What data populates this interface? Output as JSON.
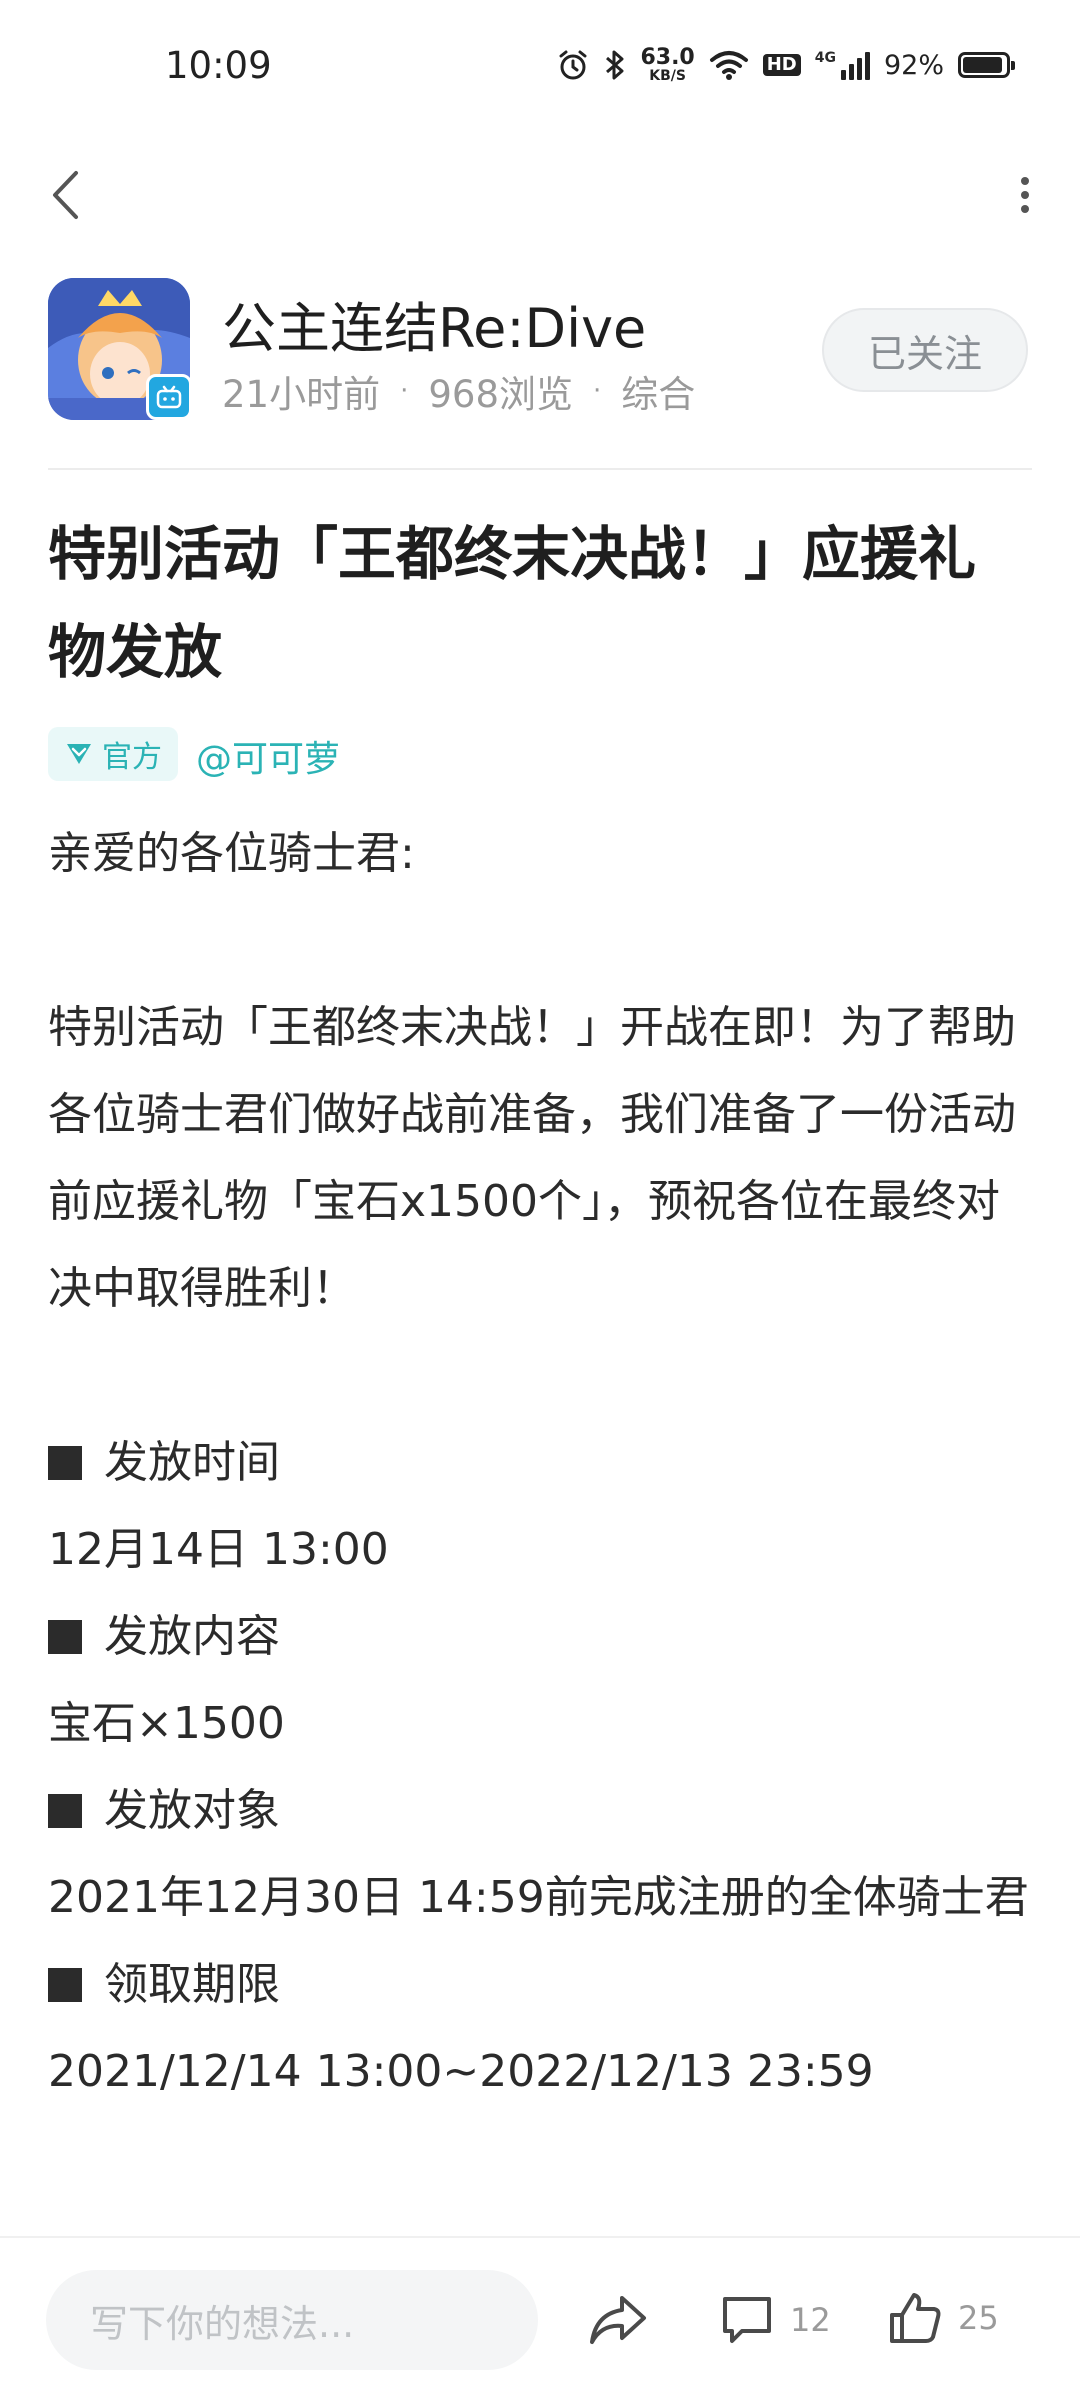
{
  "status_bar": {
    "time": "10:09",
    "net_speed_value": "63.0",
    "net_speed_unit": "KB/S",
    "hd_label": "HD",
    "signal_label": "4G",
    "battery_percent": "92%",
    "battery_level": 0.92
  },
  "header": {
    "channel_name": "公主连结Re:Dive",
    "time_ago": "21小时前",
    "views": "968浏览",
    "category": "综合",
    "follow_label": "已关注"
  },
  "post": {
    "title": "特别活动「王都终末决战！」应援礼物发放",
    "official_label": "官方",
    "author": "@可可萝",
    "greeting": "亲爱的各位骑士君:",
    "intro": "特别活动「王都终末决战！」开战在即！为了帮助各位骑士君们做好战前准备，我们准备了一份活动前应援礼物「宝石x1500个」，预祝各位在最终对决中取得胜利！",
    "sections": [
      {
        "heading": "发放时间",
        "value": "12月14日 13:00"
      },
      {
        "heading": "发放内容",
        "value": "宝石×1500"
      },
      {
        "heading": "发放对象",
        "value": "2021年12月30日 14:59前完成注册的全体骑士君"
      },
      {
        "heading": "领取期限",
        "value": "2021/12/14 13:00~2022/12/13 23:59"
      }
    ]
  },
  "bottom_bar": {
    "comment_placeholder": "写下你的想法...",
    "comment_count": "12",
    "like_count": "25"
  },
  "colors": {
    "accent": "#2bb3b5",
    "text": "#2b2b2b",
    "muted": "#9a9a9a"
  },
  "icons": [
    "alarm-icon",
    "bluetooth-icon",
    "wifi-icon",
    "signal-icon",
    "battery-icon",
    "back-arrow-icon",
    "more-vertical-icon",
    "app-logo-icon",
    "bilibili-badge-icon",
    "official-verified-icon",
    "share-icon",
    "comment-icon",
    "like-icon"
  ]
}
